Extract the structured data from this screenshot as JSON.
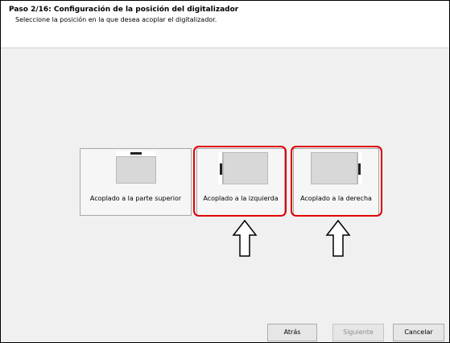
{
  "header": {
    "title": "Paso 2/16: Configuración de la posición del digitalizador",
    "subtitle": "Seleccione la posición en la que desea acoplar el digitalizador."
  },
  "options": [
    {
      "label": "Acoplado a la parte superior",
      "highlighted": false
    },
    {
      "label": "Acoplado a la izquierda",
      "highlighted": true
    },
    {
      "label": "Acoplado a la derecha",
      "highlighted": true
    }
  ],
  "buttons": {
    "back": "Atrás",
    "next": "Siguiente",
    "cancel": "Cancelar"
  },
  "colors": {
    "highlight": "#e00000",
    "panel_background": "#f0f0f0",
    "disabled_text": "#8c8c8c"
  }
}
